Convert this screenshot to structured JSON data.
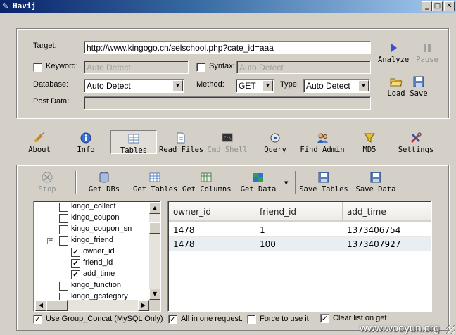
{
  "window": {
    "title": "Havij",
    "min": "_",
    "max": "□",
    "close": "✕"
  },
  "form": {
    "target_label": "Target:",
    "target_value": "http://www.kingogo.cn/selschool.php?cate_id=aaa",
    "keyword_label": "Keyword:",
    "keyword_placeholder": "Auto Detect",
    "syntax_label": "Syntax:",
    "syntax_placeholder": "Auto Detect",
    "database_label": "Database:",
    "database_value": "Auto Detect",
    "method_label": "Method:",
    "method_value": "GET",
    "type_label": "Type:",
    "type_value": "Auto Detect",
    "postdata_label": "Post Data:"
  },
  "side_buttons": {
    "analyze": "Analyze",
    "pause": "Pause",
    "load": "Load",
    "save": "Save"
  },
  "main_toolbar": [
    {
      "label": "About",
      "icon": "syringe-icon"
    },
    {
      "label": "Info",
      "icon": "info-icon"
    },
    {
      "label": "Tables",
      "icon": "tables-icon"
    },
    {
      "label": "Read Files",
      "icon": "file-icon"
    },
    {
      "label": "Cmd Shell",
      "icon": "terminal-icon"
    },
    {
      "label": "Query",
      "icon": "query-icon"
    },
    {
      "label": "Find Admin",
      "icon": "admin-icon"
    },
    {
      "label": "MD5",
      "icon": "funnel-icon"
    },
    {
      "label": "Settings",
      "icon": "tools-icon"
    }
  ],
  "tables_toolbar": {
    "stop": "Stop",
    "get_dbs": "Get DBs",
    "get_tables": "Get Tables",
    "get_columns": "Get Columns",
    "get_data": "Get Data",
    "save_tables": "Save Tables",
    "save_data": "Save Data"
  },
  "tree": [
    {
      "label": "kingo_collect",
      "checked": false,
      "level": 0
    },
    {
      "label": "kingo_coupon",
      "checked": false,
      "level": 0
    },
    {
      "label": "kingo_coupon_sn",
      "checked": false,
      "level": 0
    },
    {
      "label": "kingo_friend",
      "checked": false,
      "level": 0,
      "expanded": true
    },
    {
      "label": "owner_id",
      "checked": true,
      "level": 1
    },
    {
      "label": "friend_id",
      "checked": true,
      "level": 1
    },
    {
      "label": "add_time",
      "checked": true,
      "level": 1
    },
    {
      "label": "kingo_function",
      "checked": false,
      "level": 0
    },
    {
      "label": "kingo_gcategory",
      "checked": false,
      "level": 0
    }
  ],
  "grid": {
    "columns": [
      "owner_id",
      "friend_id",
      "add_time"
    ],
    "rows": [
      [
        "1478",
        "1",
        "1373406754"
      ],
      [
        "1478",
        "100",
        "1373407927"
      ]
    ]
  },
  "options": {
    "group_concat": {
      "label": "Use Group_Concat (MySQL Only)",
      "checked": true
    },
    "all_in_one": {
      "label": "All in one request.",
      "checked": true
    },
    "force": {
      "label": "Force to use it",
      "checked": false
    },
    "clear_list": {
      "label": "Clear list on get",
      "checked": true
    }
  },
  "watermark": "www.wooyun.org",
  "colors": {
    "titlebar": "#0a246a",
    "face": "#d4d0c8",
    "selected_row": "#e8eef2"
  }
}
